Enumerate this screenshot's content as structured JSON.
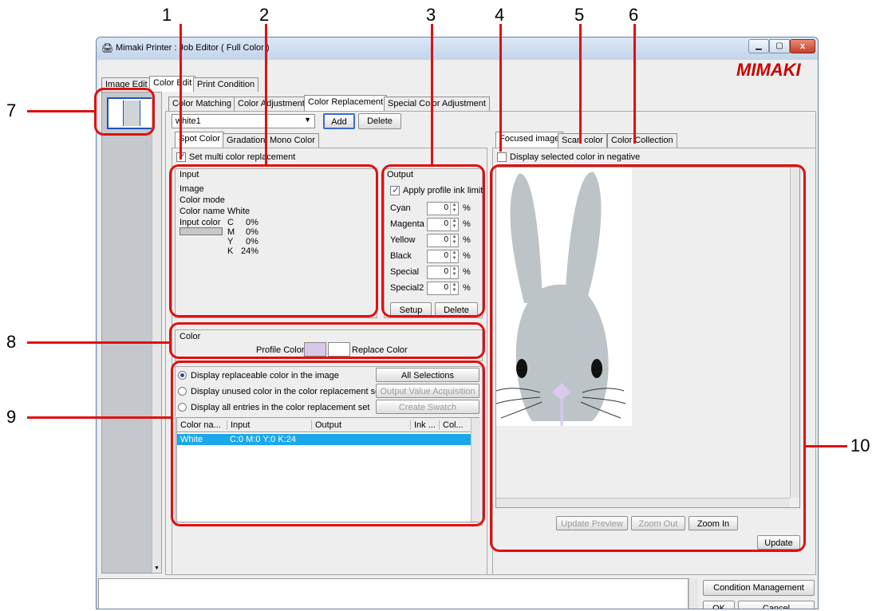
{
  "callouts": [
    "1",
    "2",
    "3",
    "4",
    "5",
    "6",
    "7",
    "8",
    "9",
    "10"
  ],
  "window": {
    "title": "Mimaki Printer : Job Editor ( Full Color )",
    "brand": "MIMAKI"
  },
  "main_tabs": [
    "Image Edit",
    "Color Edit",
    "Print Condition"
  ],
  "sub_tabs": [
    "Color Matching",
    "Color Adjustment",
    "Color Replacement",
    "Special Color Adjustment"
  ],
  "set_select": {
    "value": "white1"
  },
  "buttons": {
    "add": "Add",
    "delete": "Delete",
    "setup": "Setup",
    "output_delete": "Delete",
    "all_selections": "All Selections",
    "output_value_acq": "Output Value Acquisition",
    "create_swatch": "Create Swatch",
    "update_preview": "Update Preview",
    "zoom_out": "Zoom Out",
    "zoom_in": "Zoom In",
    "update": "Update",
    "condition_management": "Condition Management",
    "ok": "OK",
    "cancel": "Cancel"
  },
  "color_tabs": [
    "Spot Color",
    "Gradation",
    "Mono Color"
  ],
  "set_multi_label": "Set multi color replacement",
  "input_group": {
    "title": "Input",
    "image_label": "Image",
    "color_mode_label": "Color mode",
    "color_name_label": "Color name",
    "color_name_value": "White",
    "input_color_label": "Input color",
    "swatch_color": "#c8c8c8",
    "channels": [
      {
        "k": "C",
        "v": "0%"
      },
      {
        "k": "M",
        "v": "0%"
      },
      {
        "k": "Y",
        "v": "0%"
      },
      {
        "k": "K",
        "v": "24%"
      }
    ]
  },
  "output_group": {
    "title": "Output",
    "apply_label": "Apply profile ink limit",
    "inks": [
      {
        "name": "Cyan",
        "value": "0"
      },
      {
        "name": "Magenta",
        "value": "0"
      },
      {
        "name": "Yellow",
        "value": "0"
      },
      {
        "name": "Black",
        "value": "0"
      },
      {
        "name": "Special",
        "value": "0"
      },
      {
        "name": "Special2",
        "value": "0"
      }
    ],
    "unit": "%"
  },
  "color_group": {
    "title": "Color",
    "profile_label": "Profile Color",
    "replace_label": "Replace Color",
    "profile_swatch": "#d7c8e8",
    "replace_swatch": "#ffffff"
  },
  "radios": [
    "Display replaceable color in the image",
    "Display unused color in the color replacement set",
    "Display all entries in the color replacement set"
  ],
  "table": {
    "headers": [
      "Color na...",
      "Input",
      "Output",
      "Ink ...",
      "Col..."
    ],
    "rows": [
      {
        "name": "White",
        "input": "C:0 M:0 Y:0 K:24",
        "output": "",
        "ink": "",
        "col": ""
      }
    ],
    "selected_color": "#1aa8e8"
  },
  "right_tabs": [
    "Focused image",
    "Scan color",
    "Color Collection"
  ],
  "negative_label": "Display selected color in negative",
  "accent_red": "#e01010",
  "brand_color": "#cc0000"
}
